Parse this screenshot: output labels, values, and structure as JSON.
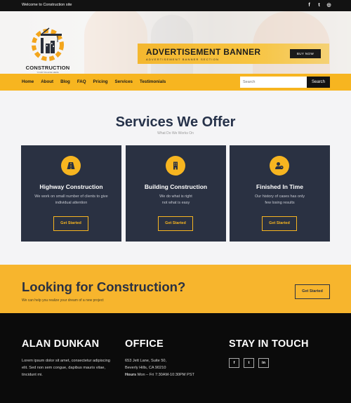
{
  "topbar": {
    "welcome": "Welcome to Construction site",
    "social": [
      {
        "icon": "facebook-icon",
        "glyph": "f"
      },
      {
        "icon": "twitter-icon",
        "glyph": "t"
      },
      {
        "icon": "instagram-icon",
        "glyph": "◎"
      }
    ]
  },
  "logo": {
    "name": "CONSTRUCTION",
    "tagline": "YOUR TAGLINE HERE"
  },
  "advertisement": {
    "title": "ADVERTISEMENT BANNER",
    "subtitle": "ADVERTISEMENT BANNER SECTION",
    "button": "BUY NOW"
  },
  "nav": {
    "items": [
      "Home",
      "About",
      "Blog",
      "FAQ",
      "Pricing",
      "Services",
      "Testimonials"
    ],
    "search_placeholder": "Search",
    "search_button": "Search"
  },
  "services": {
    "title": "Services We Offer",
    "subtitle": "What Do We Works On",
    "cards": [
      {
        "icon": "road-icon",
        "title": "Highway Construction",
        "desc_lines": [
          "We work on small number of clients to give",
          "individual attention"
        ],
        "button": "Get Started"
      },
      {
        "icon": "building-icon",
        "title": "Building Construction",
        "desc_lines": [
          "We do what is right",
          "not what is easy"
        ],
        "button": "Get Started"
      },
      {
        "icon": "user-clock-icon",
        "title": "Finished In Time",
        "desc_lines": [
          "Our history of cases has only",
          "few losing results"
        ],
        "button": "Get Started"
      }
    ]
  },
  "cta": {
    "title": "Looking for Construction?",
    "subtitle": "We can help you realize your dream of a new project",
    "button": "Get Started"
  },
  "footer": {
    "col1": {
      "title": "ALAN DUNKAN",
      "lines": [
        "Lorem ipsum dolor sit amet, consectetur adipiscing",
        "elit. Sed non sem congue, dapibus mauris vitae,",
        "tincidunt mi."
      ]
    },
    "col2": {
      "title": "OFFICE",
      "address1": "653 Jett Lane, Suite 50,",
      "address2": "Beverly Hills, CA 90210",
      "hours_label": "Hours",
      "hours_value": " Mon – Fri 7:30AM-10:30PM PST"
    },
    "col3": {
      "title": "STAY IN TOUCH",
      "social": [
        {
          "icon": "facebook-icon",
          "glyph": "f"
        },
        {
          "icon": "twitter-icon",
          "glyph": "t"
        },
        {
          "icon": "linkedin-icon",
          "glyph": "in"
        }
      ]
    }
  },
  "colors": {
    "accent": "#f7b520",
    "dark": "#2a3142",
    "footer": "#0b0b0b"
  }
}
